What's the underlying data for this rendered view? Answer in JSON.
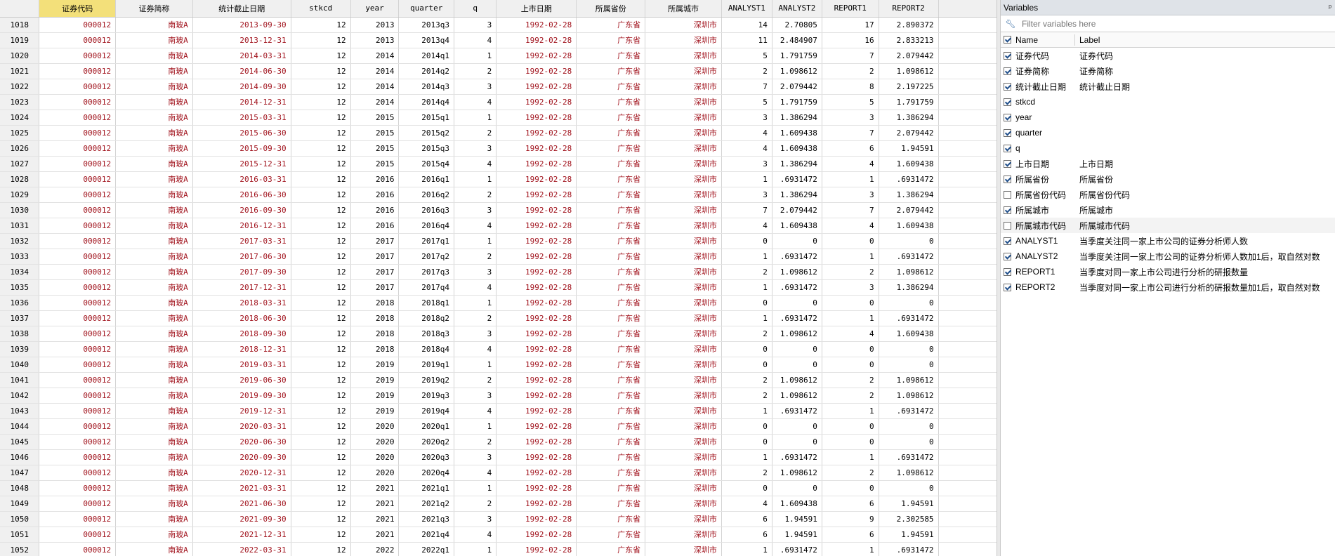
{
  "grid": {
    "columns": [
      "证券代码",
      "证券简称",
      "统计截止日期",
      "stkcd",
      "year",
      "quarter",
      "q",
      "上市日期",
      "所属省份",
      "所属城市",
      "ANALYST1",
      "ANALYST2",
      "REPORT1",
      "REPORT2"
    ],
    "selected_column": "证券代码",
    "string_columns": [
      0,
      1,
      2,
      7,
      8,
      9
    ],
    "rows": [
      [
        "1018",
        "000012",
        "南玻A",
        "2013-09-30",
        "12",
        "2013",
        "2013q3",
        "3",
        "1992-02-28",
        "广东省",
        "深圳市",
        "14",
        "2.70805",
        "17",
        "2.890372"
      ],
      [
        "1019",
        "000012",
        "南玻A",
        "2013-12-31",
        "12",
        "2013",
        "2013q4",
        "4",
        "1992-02-28",
        "广东省",
        "深圳市",
        "11",
        "2.484907",
        "16",
        "2.833213"
      ],
      [
        "1020",
        "000012",
        "南玻A",
        "2014-03-31",
        "12",
        "2014",
        "2014q1",
        "1",
        "1992-02-28",
        "广东省",
        "深圳市",
        "5",
        "1.791759",
        "7",
        "2.079442"
      ],
      [
        "1021",
        "000012",
        "南玻A",
        "2014-06-30",
        "12",
        "2014",
        "2014q2",
        "2",
        "1992-02-28",
        "广东省",
        "深圳市",
        "2",
        "1.098612",
        "2",
        "1.098612"
      ],
      [
        "1022",
        "000012",
        "南玻A",
        "2014-09-30",
        "12",
        "2014",
        "2014q3",
        "3",
        "1992-02-28",
        "广东省",
        "深圳市",
        "7",
        "2.079442",
        "8",
        "2.197225"
      ],
      [
        "1023",
        "000012",
        "南玻A",
        "2014-12-31",
        "12",
        "2014",
        "2014q4",
        "4",
        "1992-02-28",
        "广东省",
        "深圳市",
        "5",
        "1.791759",
        "5",
        "1.791759"
      ],
      [
        "1024",
        "000012",
        "南玻A",
        "2015-03-31",
        "12",
        "2015",
        "2015q1",
        "1",
        "1992-02-28",
        "广东省",
        "深圳市",
        "3",
        "1.386294",
        "3",
        "1.386294"
      ],
      [
        "1025",
        "000012",
        "南玻A",
        "2015-06-30",
        "12",
        "2015",
        "2015q2",
        "2",
        "1992-02-28",
        "广东省",
        "深圳市",
        "4",
        "1.609438",
        "7",
        "2.079442"
      ],
      [
        "1026",
        "000012",
        "南玻A",
        "2015-09-30",
        "12",
        "2015",
        "2015q3",
        "3",
        "1992-02-28",
        "广东省",
        "深圳市",
        "4",
        "1.609438",
        "6",
        "1.94591"
      ],
      [
        "1027",
        "000012",
        "南玻A",
        "2015-12-31",
        "12",
        "2015",
        "2015q4",
        "4",
        "1992-02-28",
        "广东省",
        "深圳市",
        "3",
        "1.386294",
        "4",
        "1.609438"
      ],
      [
        "1028",
        "000012",
        "南玻A",
        "2016-03-31",
        "12",
        "2016",
        "2016q1",
        "1",
        "1992-02-28",
        "广东省",
        "深圳市",
        "1",
        ".6931472",
        "1",
        ".6931472"
      ],
      [
        "1029",
        "000012",
        "南玻A",
        "2016-06-30",
        "12",
        "2016",
        "2016q2",
        "2",
        "1992-02-28",
        "广东省",
        "深圳市",
        "3",
        "1.386294",
        "3",
        "1.386294"
      ],
      [
        "1030",
        "000012",
        "南玻A",
        "2016-09-30",
        "12",
        "2016",
        "2016q3",
        "3",
        "1992-02-28",
        "广东省",
        "深圳市",
        "7",
        "2.079442",
        "7",
        "2.079442"
      ],
      [
        "1031",
        "000012",
        "南玻A",
        "2016-12-31",
        "12",
        "2016",
        "2016q4",
        "4",
        "1992-02-28",
        "广东省",
        "深圳市",
        "4",
        "1.609438",
        "4",
        "1.609438"
      ],
      [
        "1032",
        "000012",
        "南玻A",
        "2017-03-31",
        "12",
        "2017",
        "2017q1",
        "1",
        "1992-02-28",
        "广东省",
        "深圳市",
        "0",
        "0",
        "0",
        "0"
      ],
      [
        "1033",
        "000012",
        "南玻A",
        "2017-06-30",
        "12",
        "2017",
        "2017q2",
        "2",
        "1992-02-28",
        "广东省",
        "深圳市",
        "1",
        ".6931472",
        "1",
        ".6931472"
      ],
      [
        "1034",
        "000012",
        "南玻A",
        "2017-09-30",
        "12",
        "2017",
        "2017q3",
        "3",
        "1992-02-28",
        "广东省",
        "深圳市",
        "2",
        "1.098612",
        "2",
        "1.098612"
      ],
      [
        "1035",
        "000012",
        "南玻A",
        "2017-12-31",
        "12",
        "2017",
        "2017q4",
        "4",
        "1992-02-28",
        "广东省",
        "深圳市",
        "1",
        ".6931472",
        "3",
        "1.386294"
      ],
      [
        "1036",
        "000012",
        "南玻A",
        "2018-03-31",
        "12",
        "2018",
        "2018q1",
        "1",
        "1992-02-28",
        "广东省",
        "深圳市",
        "0",
        "0",
        "0",
        "0"
      ],
      [
        "1037",
        "000012",
        "南玻A",
        "2018-06-30",
        "12",
        "2018",
        "2018q2",
        "2",
        "1992-02-28",
        "广东省",
        "深圳市",
        "1",
        ".6931472",
        "1",
        ".6931472"
      ],
      [
        "1038",
        "000012",
        "南玻A",
        "2018-09-30",
        "12",
        "2018",
        "2018q3",
        "3",
        "1992-02-28",
        "广东省",
        "深圳市",
        "2",
        "1.098612",
        "4",
        "1.609438"
      ],
      [
        "1039",
        "000012",
        "南玻A",
        "2018-12-31",
        "12",
        "2018",
        "2018q4",
        "4",
        "1992-02-28",
        "广东省",
        "深圳市",
        "0",
        "0",
        "0",
        "0"
      ],
      [
        "1040",
        "000012",
        "南玻A",
        "2019-03-31",
        "12",
        "2019",
        "2019q1",
        "1",
        "1992-02-28",
        "广东省",
        "深圳市",
        "0",
        "0",
        "0",
        "0"
      ],
      [
        "1041",
        "000012",
        "南玻A",
        "2019-06-30",
        "12",
        "2019",
        "2019q2",
        "2",
        "1992-02-28",
        "广东省",
        "深圳市",
        "2",
        "1.098612",
        "2",
        "1.098612"
      ],
      [
        "1042",
        "000012",
        "南玻A",
        "2019-09-30",
        "12",
        "2019",
        "2019q3",
        "3",
        "1992-02-28",
        "广东省",
        "深圳市",
        "2",
        "1.098612",
        "2",
        "1.098612"
      ],
      [
        "1043",
        "000012",
        "南玻A",
        "2019-12-31",
        "12",
        "2019",
        "2019q4",
        "4",
        "1992-02-28",
        "广东省",
        "深圳市",
        "1",
        ".6931472",
        "1",
        ".6931472"
      ],
      [
        "1044",
        "000012",
        "南玻A",
        "2020-03-31",
        "12",
        "2020",
        "2020q1",
        "1",
        "1992-02-28",
        "广东省",
        "深圳市",
        "0",
        "0",
        "0",
        "0"
      ],
      [
        "1045",
        "000012",
        "南玻A",
        "2020-06-30",
        "12",
        "2020",
        "2020q2",
        "2",
        "1992-02-28",
        "广东省",
        "深圳市",
        "0",
        "0",
        "0",
        "0"
      ],
      [
        "1046",
        "000012",
        "南玻A",
        "2020-09-30",
        "12",
        "2020",
        "2020q3",
        "3",
        "1992-02-28",
        "广东省",
        "深圳市",
        "1",
        ".6931472",
        "1",
        ".6931472"
      ],
      [
        "1047",
        "000012",
        "南玻A",
        "2020-12-31",
        "12",
        "2020",
        "2020q4",
        "4",
        "1992-02-28",
        "广东省",
        "深圳市",
        "2",
        "1.098612",
        "2",
        "1.098612"
      ],
      [
        "1048",
        "000012",
        "南玻A",
        "2021-03-31",
        "12",
        "2021",
        "2021q1",
        "1",
        "1992-02-28",
        "广东省",
        "深圳市",
        "0",
        "0",
        "0",
        "0"
      ],
      [
        "1049",
        "000012",
        "南玻A",
        "2021-06-30",
        "12",
        "2021",
        "2021q2",
        "2",
        "1992-02-28",
        "广东省",
        "深圳市",
        "4",
        "1.609438",
        "6",
        "1.94591"
      ],
      [
        "1050",
        "000012",
        "南玻A",
        "2021-09-30",
        "12",
        "2021",
        "2021q3",
        "3",
        "1992-02-28",
        "广东省",
        "深圳市",
        "6",
        "1.94591",
        "9",
        "2.302585"
      ],
      [
        "1051",
        "000012",
        "南玻A",
        "2021-12-31",
        "12",
        "2021",
        "2021q4",
        "4",
        "1992-02-28",
        "广东省",
        "深圳市",
        "6",
        "1.94591",
        "6",
        "1.94591"
      ],
      [
        "1052",
        "000012",
        "南玻A",
        "2022-03-31",
        "12",
        "2022",
        "2022q1",
        "1",
        "1992-02-28",
        "广东省",
        "深圳市",
        "1",
        ".6931472",
        "1",
        ".6931472"
      ]
    ]
  },
  "variables": {
    "title": "Variables",
    "pin_glyph": "ᵖ",
    "filter_placeholder": "Filter variables here",
    "header": {
      "name": "Name",
      "label": "Label",
      "checked": true
    },
    "items": [
      {
        "name": "证券代码",
        "label": "证券代码",
        "checked": true
      },
      {
        "name": "证券简称",
        "label": "证券简称",
        "checked": true
      },
      {
        "name": "统计截止日期",
        "label": "统计截止日期",
        "checked": true
      },
      {
        "name": "stkcd",
        "label": "",
        "checked": true
      },
      {
        "name": "year",
        "label": "",
        "checked": true
      },
      {
        "name": "quarter",
        "label": "",
        "checked": true
      },
      {
        "name": "q",
        "label": "",
        "checked": true
      },
      {
        "name": "上市日期",
        "label": "上市日期",
        "checked": true
      },
      {
        "name": "所属省份",
        "label": "所属省份",
        "checked": true
      },
      {
        "name": "所属省份代码",
        "label": "所属省份代码",
        "checked": false
      },
      {
        "name": "所属城市",
        "label": "所属城市",
        "checked": true
      },
      {
        "name": "所属城市代码",
        "label": "所属城市代码",
        "checked": false
      },
      {
        "name": "ANALYST1",
        "label": "当季度关注同一家上市公司的证券分析师人数",
        "checked": true
      },
      {
        "name": "ANALYST2",
        "label": "当季度关注同一家上市公司的证券分析师人数加1后，取自然对数",
        "checked": true
      },
      {
        "name": "REPORT1",
        "label": "当季度对同一家上市公司进行分析的研报数量",
        "checked": true
      },
      {
        "name": "REPORT2",
        "label": "当季度对同一家上市公司进行分析的研报数量加1后，取自然对数",
        "checked": true
      }
    ]
  }
}
